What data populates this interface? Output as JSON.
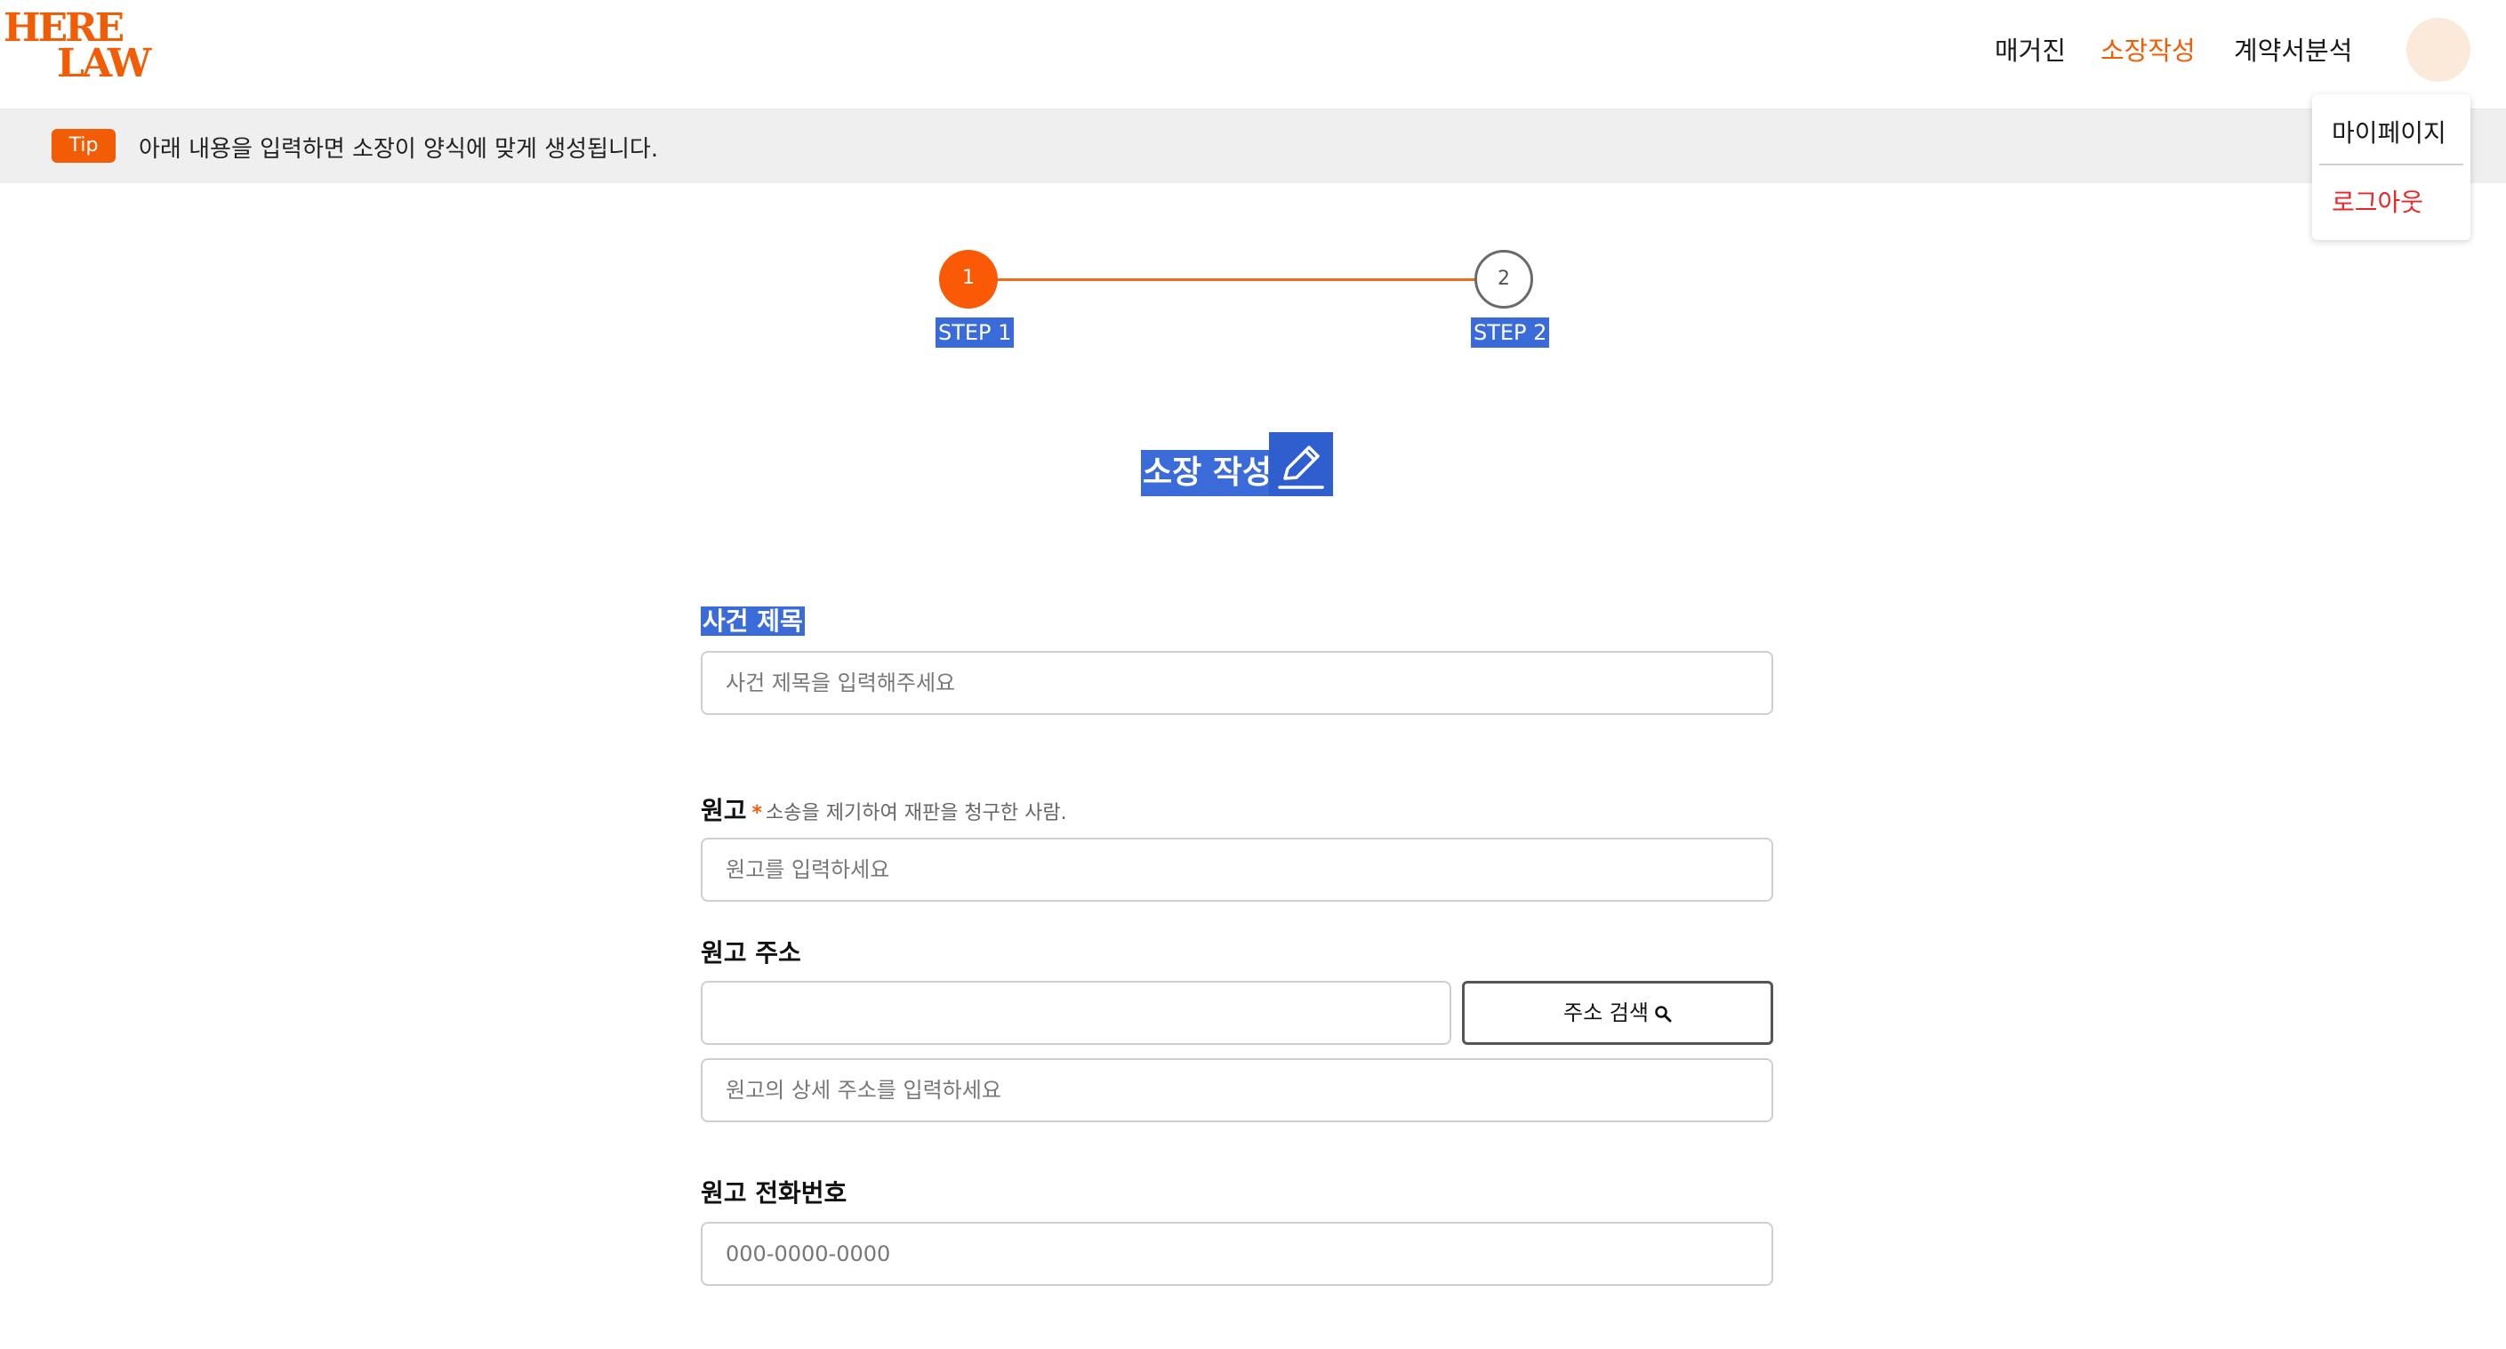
{
  "header": {
    "logo": {
      "line1": "HERE",
      "line2": "LAW"
    },
    "nav": [
      {
        "label": "매거진",
        "active": false
      },
      {
        "label": "소장작성",
        "active": true
      },
      {
        "label": "계약서분석",
        "active": false
      }
    ],
    "avatar_color": "#fbe9d9"
  },
  "user_menu": {
    "mypage": "마이페이지",
    "logout": "로그아웃"
  },
  "tip": {
    "badge": "Tip",
    "text": "아래 내용을 입력하면 소장이 양식에 맞게 생성됩니다."
  },
  "stepper": {
    "current": 1,
    "steps": [
      {
        "number": "1",
        "label": "STEP 1"
      },
      {
        "number": "2",
        "label": "STEP 2"
      }
    ]
  },
  "page_title": "소장 작성",
  "form": {
    "case_title": {
      "label": "사건 제목",
      "placeholder": "사건 제목을 입력해주세요",
      "value": ""
    },
    "plaintiff": {
      "label": "원고",
      "required_mark": "*",
      "hint": "소송을 제기하여 재판을 청구한 사람.",
      "placeholder": "원고를 입력하세요",
      "value": ""
    },
    "plaintiff_address": {
      "label": "원고 주소",
      "value": "",
      "search_button": "주소 검색",
      "detail_placeholder": "원고의 상세 주소를 입력하세요"
    },
    "plaintiff_phone": {
      "label": "원고 전화번호",
      "placeholder": "000-0000-0000",
      "value": ""
    }
  },
  "colors": {
    "accent": "#f25c05",
    "highlight": "#3a6bd8",
    "logout": "#e8262a"
  }
}
